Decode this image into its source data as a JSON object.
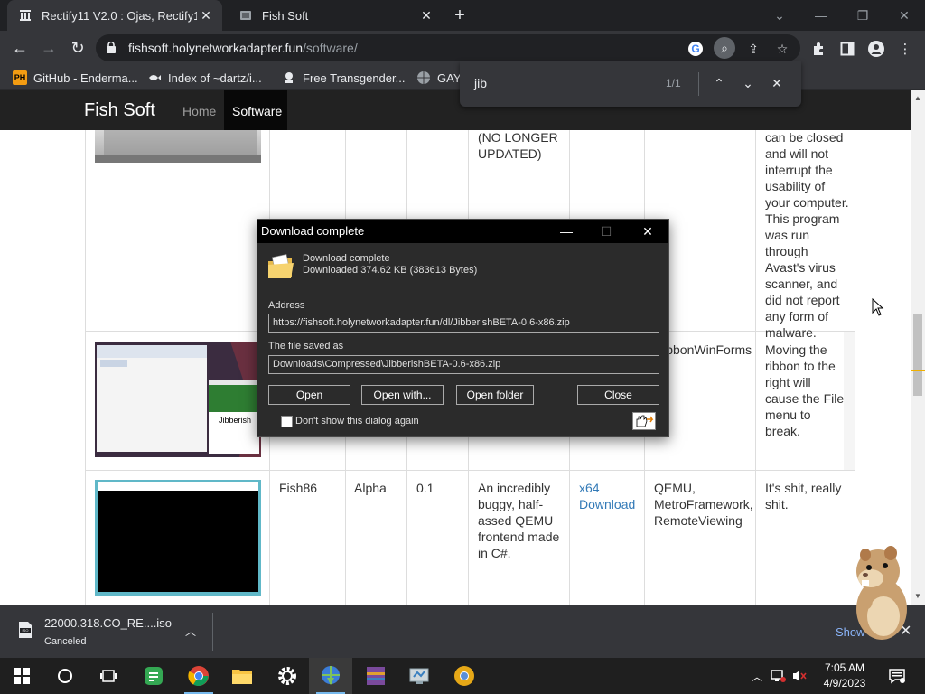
{
  "browser": {
    "tabs": [
      {
        "title": "Rectify11 V2.0 : Ojas, Rectify11"
      },
      {
        "title": "Fish Soft"
      }
    ],
    "url_host": "fishsoft.holynetworkadapter.fun",
    "url_path": "/software/",
    "bookmarks": [
      {
        "label": "GitHub - Enderma...",
        "icon": "PH"
      },
      {
        "label": "Index of ~dartz/i...",
        "icon": "fish-icon"
      },
      {
        "label": "Free Transgender...",
        "icon": "site-icon"
      },
      {
        "label": "GAY",
        "icon": "globe-icon"
      }
    ],
    "find": {
      "query": "jib",
      "count": "1/1"
    }
  },
  "site": {
    "brand": "Fish Soft",
    "nav": [
      "Home",
      "Software"
    ]
  },
  "table": {
    "row1": {
      "description": "(NO LONGER UPDATED)",
      "notes": "can be closed and will not interrupt the usability of your computer. This program was run through Avast's virus scanner, and did not report any form of malware."
    },
    "row2": {
      "thumb_label": "Jibberish",
      "frameworks": "RibbonWinForms",
      "notes": "Moving the ribbon to the right will cause the File menu to break."
    },
    "row3": {
      "name": "Fish86",
      "stage": "Alpha",
      "version": "0.1",
      "description": "An incredibly buggy, half-assed QEMU frontend made in C#.",
      "download_l1": "x64",
      "download_l2": "Download",
      "frameworks": "QEMU, MetroFramework, RemoteViewing",
      "notes": "It's shit, really shit."
    }
  },
  "dialog": {
    "title": "Download complete",
    "heading": "Download complete",
    "size_text": "Downloaded 374.62  KB (383613 Bytes)",
    "address_label": "Address",
    "address": "https://fishsoft.holynetworkadapter.fun/dl/JibberishBETA-0.6-x86.zip",
    "saved_label": "The file saved as",
    "saved_path": "Downloads\\Compressed\\JibberishBETA-0.6-x86.zip",
    "buttons": {
      "open": "Open",
      "open_with": "Open with...",
      "open_folder": "Open folder",
      "close": "Close"
    },
    "checkbox_label": "Don't show this dialog again"
  },
  "shelf": {
    "filename": "22000.318.CO_RE....iso",
    "status": "Canceled",
    "show_all": "Show all"
  },
  "taskbar": {
    "time": "7:05 AM",
    "date": "4/9/2023"
  },
  "colors": {
    "chrome_dark": "#202124",
    "chrome_toolbar": "#35363a",
    "site_nav": "#222222",
    "link": "#337ab7",
    "dialog_bg": "#2b2b2b"
  }
}
